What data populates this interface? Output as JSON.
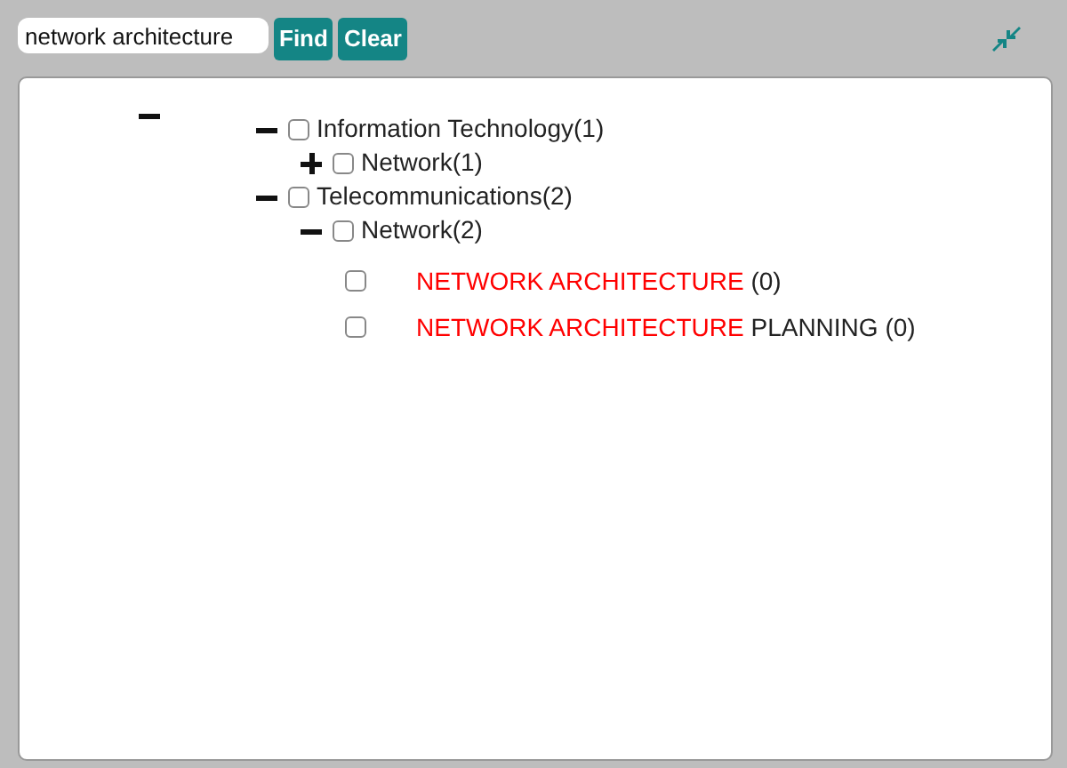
{
  "toolbar": {
    "search": {
      "value": "network architecture"
    },
    "buttons": [
      "Find",
      "Clear"
    ]
  },
  "tree": {
    "expanded": true,
    "children": [
      {
        "label": "Information Technology(1)",
        "expanded": true,
        "checked": false,
        "children": [
          {
            "label": "Network(1)",
            "expanded": false,
            "checked": false
          }
        ]
      },
      {
        "label": "Telecommunications(2)",
        "expanded": true,
        "checked": false,
        "children": [
          {
            "label": "Network(2)",
            "expanded": true,
            "checked": false,
            "leaves": [
              {
                "checked": false,
                "parts": [
                  {
                    "text": "NETWORK ARCHITECTURE",
                    "highlight": true
                  },
                  {
                    "text": " (0)",
                    "highlight": false
                  }
                ]
              },
              {
                "checked": false,
                "parts": [
                  {
                    "text": "NETWORK ARCHITECTURE",
                    "highlight": true
                  },
                  {
                    "text": " PLANNING (0)",
                    "highlight": false
                  }
                ]
              }
            ]
          }
        ]
      }
    ]
  }
}
